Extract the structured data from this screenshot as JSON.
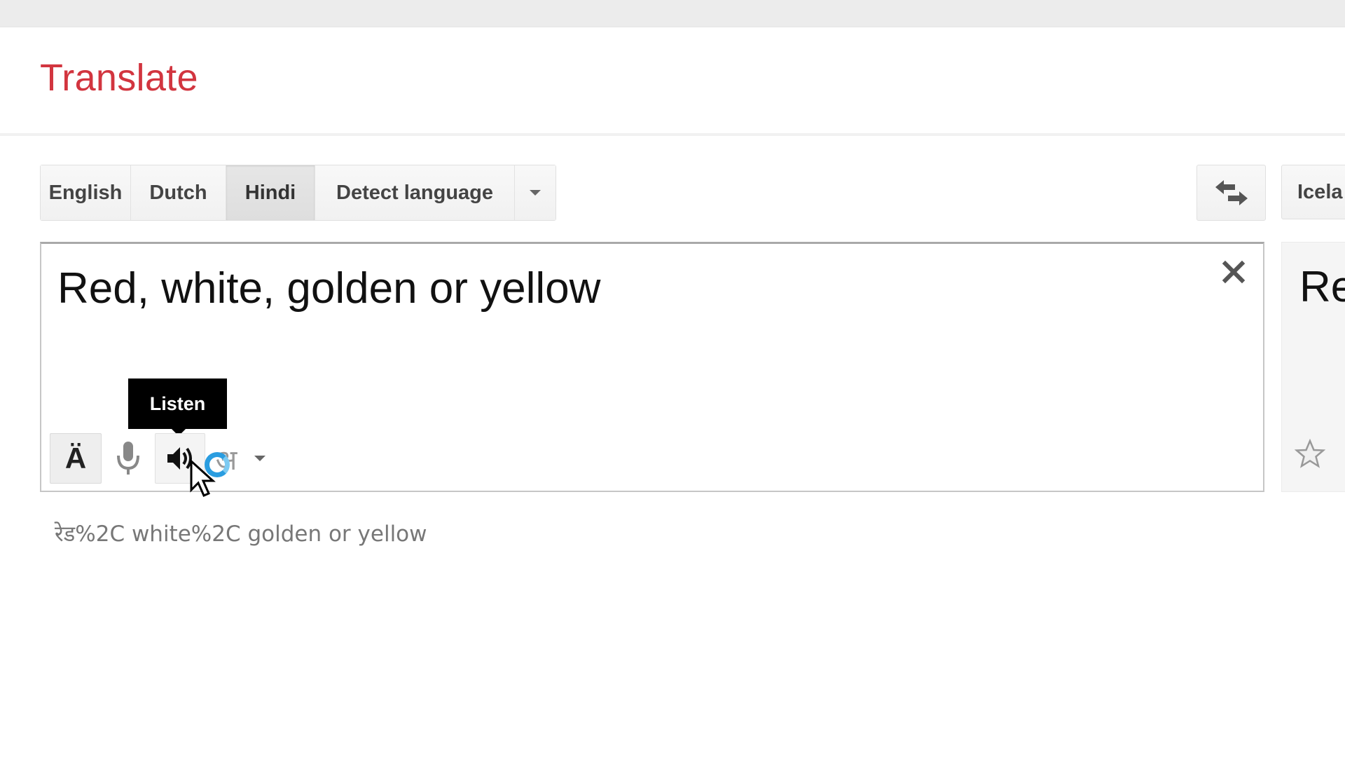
{
  "header": {
    "title": "Translate"
  },
  "source_languages": {
    "buttons": [
      {
        "label": "English",
        "active": false
      },
      {
        "label": "Dutch",
        "active": false
      },
      {
        "label": "Hindi",
        "active": true
      },
      {
        "label": "Detect language",
        "active": false
      }
    ],
    "more_icon": "chevron-down-icon"
  },
  "swap": {
    "icon": "swap-arrows-icon"
  },
  "target_language": {
    "label": "Icela"
  },
  "input": {
    "value": "Red, white, golden or yellow",
    "clear_icon": "close-icon"
  },
  "tooltip": {
    "text": "Listen"
  },
  "input_toolbar": {
    "keyboard_label": "Ä",
    "mic_icon": "microphone-icon",
    "listen_icon": "speaker-icon",
    "input_tool_label": "अ",
    "dropdown_icon": "chevron-down-icon"
  },
  "transliteration": "रेड%2C white%2C golden or yellow",
  "output": {
    "value": "Re",
    "star_icon": "star-icon"
  }
}
